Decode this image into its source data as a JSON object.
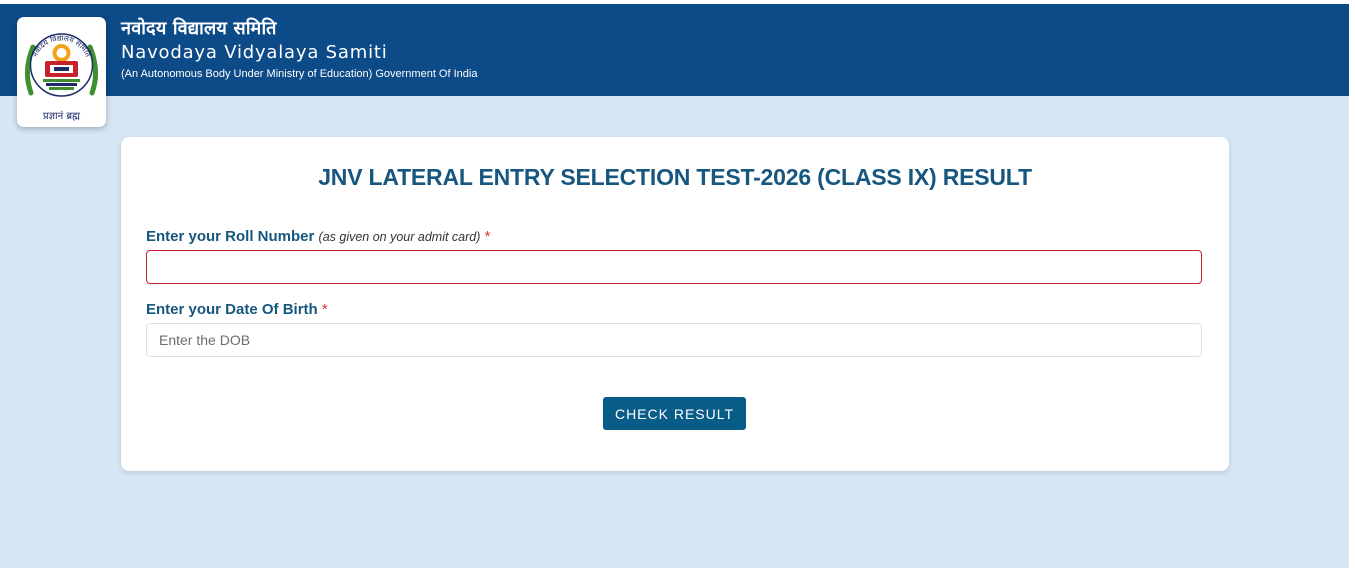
{
  "header": {
    "title_hindi": "नवोदय विद्यालय समिति",
    "title_english": "Navodaya Vidyalaya Samiti",
    "subtitle": "(An Autonomous Body Under Ministry of Education) Government Of India",
    "logo_caption": "प्रज्ञानं ब्रह्म",
    "logo_ring_text": "नवोदय विद्यालय समिति"
  },
  "form": {
    "title": "JNV LATERAL ENTRY SELECTION TEST-2026 (CLASS IX) RESULT",
    "roll": {
      "label": "Enter your Roll Number",
      "note": "(as given on your admit card)",
      "required_mark": "*",
      "value": "",
      "placeholder": ""
    },
    "dob": {
      "label": "Enter your Date Of Birth",
      "required_mark": "*",
      "value": "",
      "placeholder": "Enter the DOB"
    },
    "submit_label": "CHECK RESULT"
  },
  "colors": {
    "header_bg": "#0d4a88",
    "page_bg": "#d6e6f4",
    "accent": "#17567e",
    "button_bg": "#0a5c88",
    "error_border": "#c7222b",
    "required": "#e0342f"
  }
}
